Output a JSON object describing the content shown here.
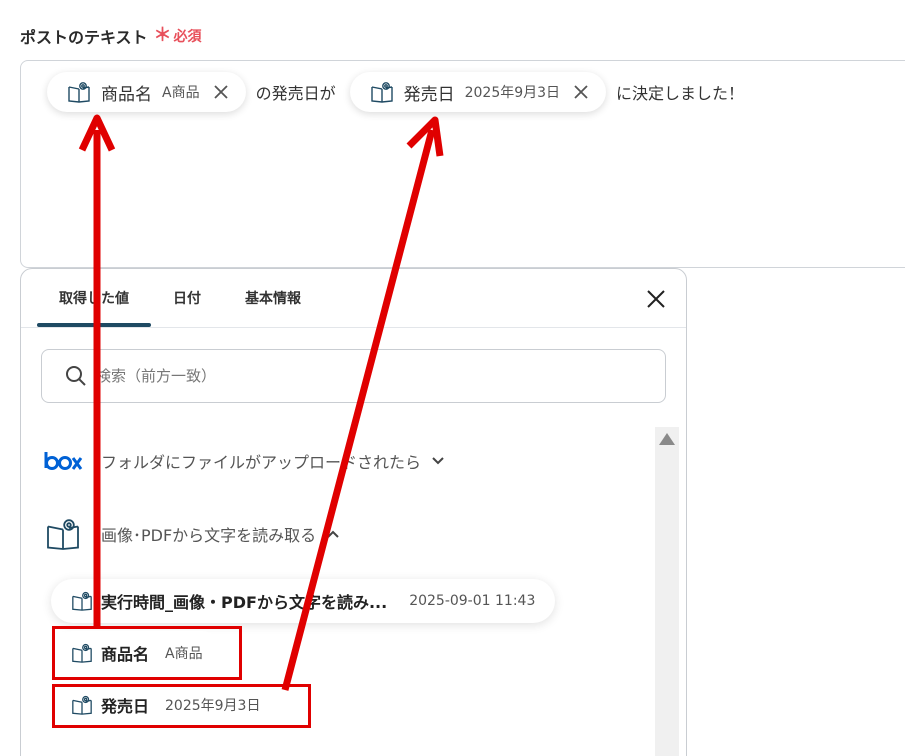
{
  "field": {
    "label": "ポストのテキスト",
    "required_mark": "＊",
    "required_text": "必須"
  },
  "post_text": {
    "pill1": {
      "name": "商品名",
      "value": "A商品"
    },
    "text1": "の発売日が",
    "pill2": {
      "name": "発売日",
      "value": "2025年9月3日"
    },
    "text2": "に決定しました！"
  },
  "panel": {
    "tabs": [
      {
        "label": "取得した値"
      },
      {
        "label": "日付"
      },
      {
        "label": "基本情報"
      }
    ],
    "search_placeholder": "検索（前方一致）",
    "sections": [
      {
        "icon": "box-logo",
        "label": "フォルダにファイルがアップロードされたら"
      },
      {
        "icon": "book-icon",
        "label": "画像･PDFから文字を読み取る"
      }
    ],
    "items": [
      {
        "name": "実行時間_画像・PDFから文字を読み...",
        "value": "2025-09-01 11:43"
      },
      {
        "name": "商品名",
        "value": "A商品"
      },
      {
        "name": "発売日",
        "value": "2025年9月3日"
      }
    ]
  },
  "colors": {
    "accent": "#1f4a63",
    "required": "#e8505b",
    "box_brand": "#0061d5",
    "annotation": "#e00000",
    "icon": "#1f4a63"
  }
}
